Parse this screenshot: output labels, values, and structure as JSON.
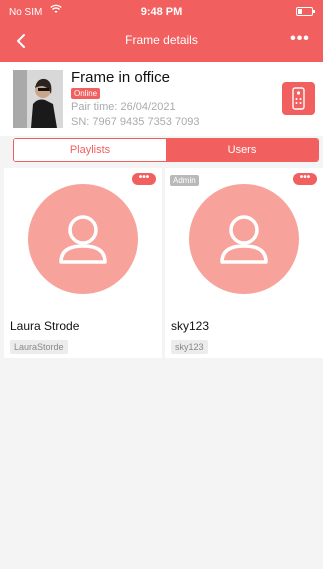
{
  "status_bar": {
    "carrier": "No SIM",
    "time": "9:48 PM"
  },
  "navbar": {
    "title": "Frame details",
    "more_label": "•••"
  },
  "frame": {
    "name": "Frame in office",
    "status": "Online",
    "pair_time": "Pair time: 26/04/2021",
    "sn": "SN: 7967 9435 7353 7093"
  },
  "tabs": [
    {
      "label": "Playlists",
      "active": false
    },
    {
      "label": "Users",
      "active": true
    }
  ],
  "users": [
    {
      "name": "Laura Strode",
      "id": "LauraStorde",
      "badge": ""
    },
    {
      "name": "sky123",
      "id": "sky123",
      "badge": "Admin"
    }
  ],
  "card_more_label": "•••",
  "colors": {
    "accent": "#f25f5f",
    "avatar_bg": "#f7a39b",
    "page_bg": "#f4f4f4"
  }
}
